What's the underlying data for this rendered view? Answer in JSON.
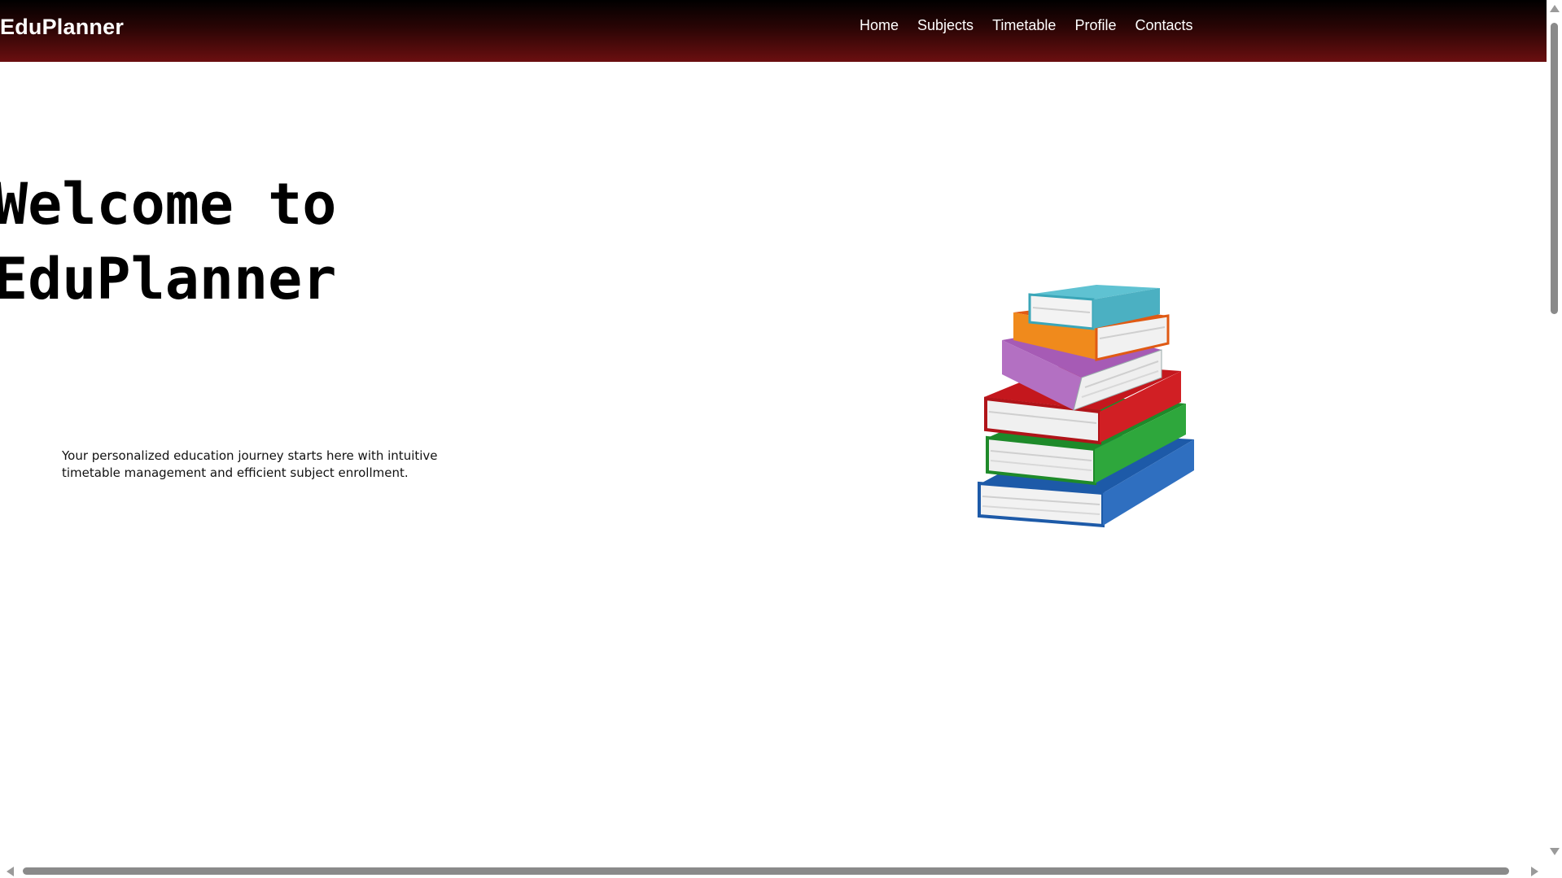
{
  "navbar": {
    "brand": "EduPlanner",
    "links": [
      "Home",
      "Subjects",
      "Timetable",
      "Profile",
      "Contacts"
    ]
  },
  "hero": {
    "title": "Welcome to\nEduPlanner",
    "description": "Your personalized education journey starts here with intuitive timetable management and efficient subject enrollment.",
    "image": "stack-of-books"
  },
  "colors": {
    "navbar_gradient_start": "#000000",
    "navbar_gradient_end": "#6b0f10",
    "text": "#000000",
    "background": "#ffffff"
  }
}
